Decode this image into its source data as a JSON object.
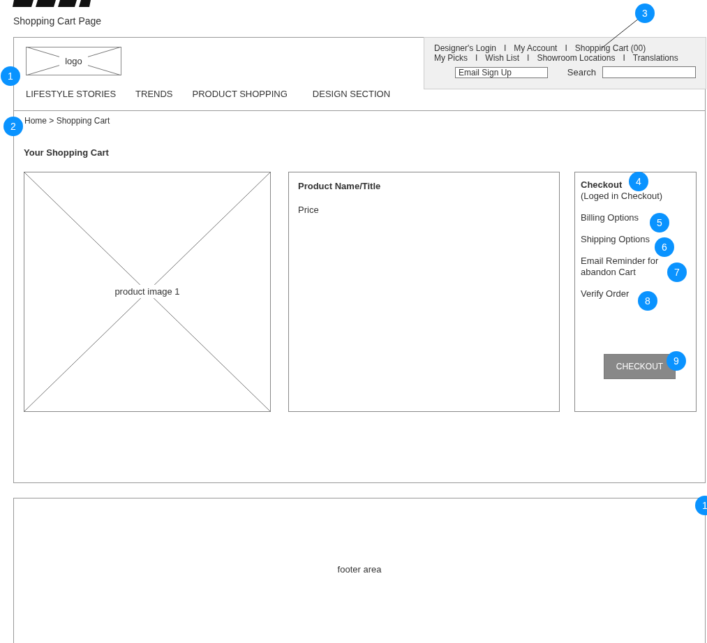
{
  "page_title": "Shopping Cart Page",
  "header": {
    "logo": "logo",
    "nav": [
      "LIFESTYLE STORIES",
      "TRENDS",
      "PRODUCT SHOPPING",
      "DESIGN SECTION"
    ],
    "utility_links_row_1": [
      "Designer's Login",
      "I",
      "My Account",
      "I",
      "Shopping Cart (00)"
    ],
    "utility_links_row_2": [
      "My Picks",
      "I",
      "Wish List",
      "I",
      "Showroom Locations",
      "I",
      "Translations"
    ],
    "email_signup": "Email Sign Up",
    "search_label": "Search"
  },
  "breadcrumb": "Home > Shopping Cart",
  "cart_title": "Your Shopping Cart",
  "product": {
    "image_label": "product image 1",
    "name": "Product Name/Title",
    "price": "Price"
  },
  "checkout_panel": {
    "title": "Checkout",
    "subtitle": "(Loged in Checkout)",
    "steps": [
      "Billing Options",
      "Shipping Options",
      "Email Reminder for abandon Cart",
      "Verify Order"
    ],
    "button": "CHECKOUT"
  },
  "footer": "footer area",
  "badges": [
    "1",
    "2",
    "3",
    "4",
    "5",
    "6",
    "7",
    "8",
    "9",
    "1"
  ]
}
